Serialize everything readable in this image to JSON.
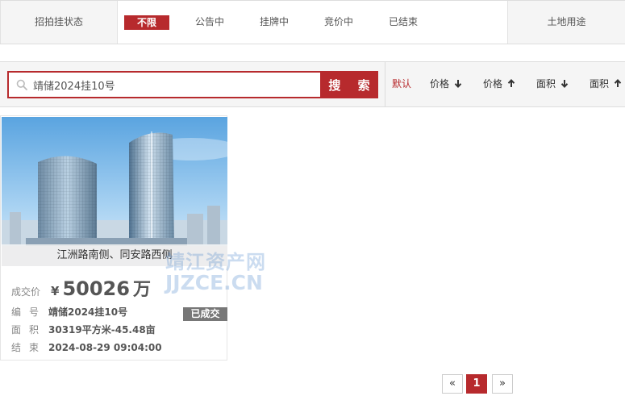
{
  "filter": {
    "label": "招拍挂状态",
    "options": [
      "不限",
      "公告中",
      "挂牌中",
      "竞价中",
      "已结束"
    ],
    "active_index": 0,
    "land_use_label": "土地用途"
  },
  "search": {
    "value": "靖储2024挂10号",
    "button_label": "搜 索"
  },
  "sort": {
    "options": [
      "默认",
      "价格",
      "价格",
      "面积",
      "面积"
    ],
    "directions": [
      "",
      "down",
      "up",
      "down",
      "up"
    ],
    "active_index": 0
  },
  "listing": {
    "location": "江洲路南侧、同安路西侧",
    "price_label": "成交价",
    "price_currency": "¥",
    "price_value": "50026",
    "price_unit": "万",
    "badge": "已成交",
    "rows": [
      {
        "key": "编号",
        "value": "靖储2024挂10号"
      },
      {
        "key": "面积",
        "value": "30319平方米-45.48亩"
      },
      {
        "key": "结束",
        "value": "2024-08-29 09:04:00"
      }
    ]
  },
  "watermark": {
    "line1": "靖江资产网",
    "line2": "JJZCE.CN"
  },
  "pagination": {
    "prev": "«",
    "current": "1",
    "next": "»"
  },
  "colors": {
    "accent": "#b72a2d",
    "badge": "#777777"
  }
}
